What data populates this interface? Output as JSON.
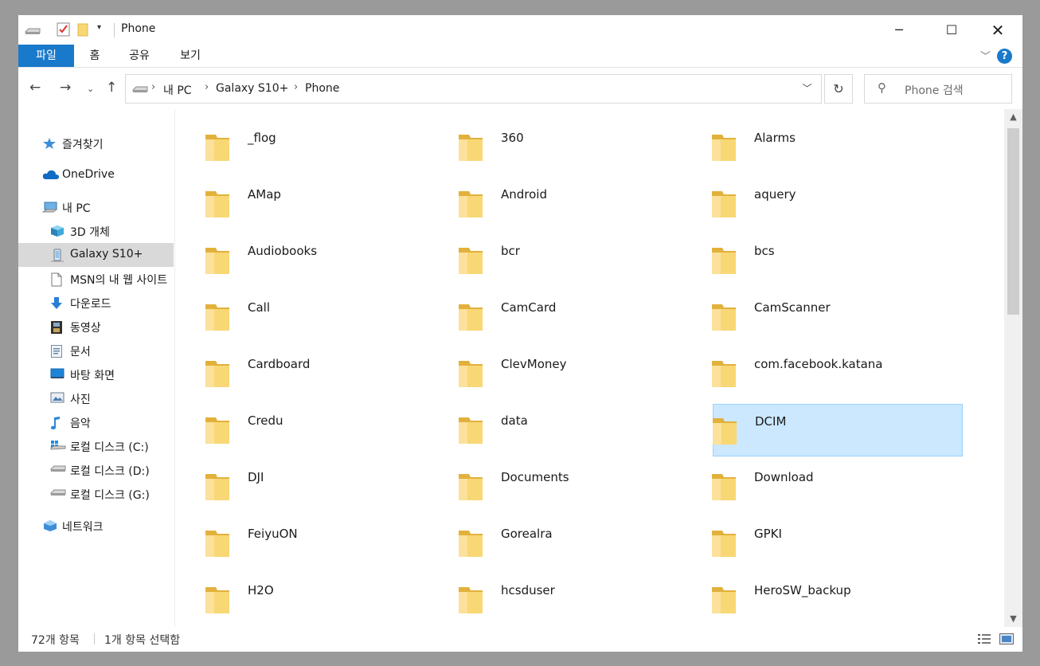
{
  "window": {
    "title": "Phone"
  },
  "ribbon": {
    "tabs": [
      "파일",
      "홈",
      "공유",
      "보기"
    ],
    "help": "?"
  },
  "nav": {
    "breadcrumb": [
      "내 PC",
      "Galaxy S10+",
      "Phone"
    ],
    "search_placeholder": "Phone 검색"
  },
  "sidebar": {
    "items": [
      {
        "label": "즐겨찾기",
        "icon": "star-icon",
        "indent": 0
      },
      {
        "label": "OneDrive",
        "icon": "cloud-icon",
        "indent": 0
      },
      {
        "label": "내 PC",
        "icon": "computer-icon",
        "indent": 0
      },
      {
        "label": "3D 개체",
        "icon": "cube-icon",
        "indent": 1
      },
      {
        "label": "Galaxy S10+",
        "icon": "phone-icon",
        "indent": 1,
        "selected": true
      },
      {
        "label": "MSN의 내 웹 사이트",
        "icon": "document-icon",
        "indent": 1
      },
      {
        "label": "다운로드",
        "icon": "download-icon",
        "indent": 1
      },
      {
        "label": "동영상",
        "icon": "video-icon",
        "indent": 1
      },
      {
        "label": "문서",
        "icon": "documents-icon",
        "indent": 1
      },
      {
        "label": "바탕 화면",
        "icon": "desktop-icon",
        "indent": 1
      },
      {
        "label": "사진",
        "icon": "pictures-icon",
        "indent": 1
      },
      {
        "label": "음악",
        "icon": "music-icon",
        "indent": 1
      },
      {
        "label": "로컬 디스크 (C:)",
        "icon": "windows-drive-icon",
        "indent": 1
      },
      {
        "label": "로컬 디스크 (D:)",
        "icon": "drive-icon",
        "indent": 1
      },
      {
        "label": "로컬 디스크 (G:)",
        "icon": "drive-icon",
        "indent": 1
      },
      {
        "label": "네트워크",
        "icon": "network-icon",
        "indent": 0
      }
    ]
  },
  "folders": [
    "_flog",
    "360",
    "Alarms",
    "AMap",
    "Android",
    "aquery",
    "Audiobooks",
    "bcr",
    "bcs",
    "Call",
    "CamCard",
    "CamScanner",
    "Cardboard",
    "ClevMoney",
    "com.facebook.katana",
    "Credu",
    "data",
    "DCIM",
    "DJI",
    "Documents",
    "Download",
    "FeiyuON",
    "Gorealra",
    "GPKI",
    "H2O",
    "hcsduser",
    "HeroSW_backup"
  ],
  "selected_folder": "DCIM",
  "status": {
    "item_count": "72개 항목",
    "selection": "1개 항목 선택함"
  },
  "colors": {
    "accent": "#1979ca",
    "selection": "#cce8ff",
    "selection_border": "#99d1ff",
    "folder": "#f8d775"
  }
}
